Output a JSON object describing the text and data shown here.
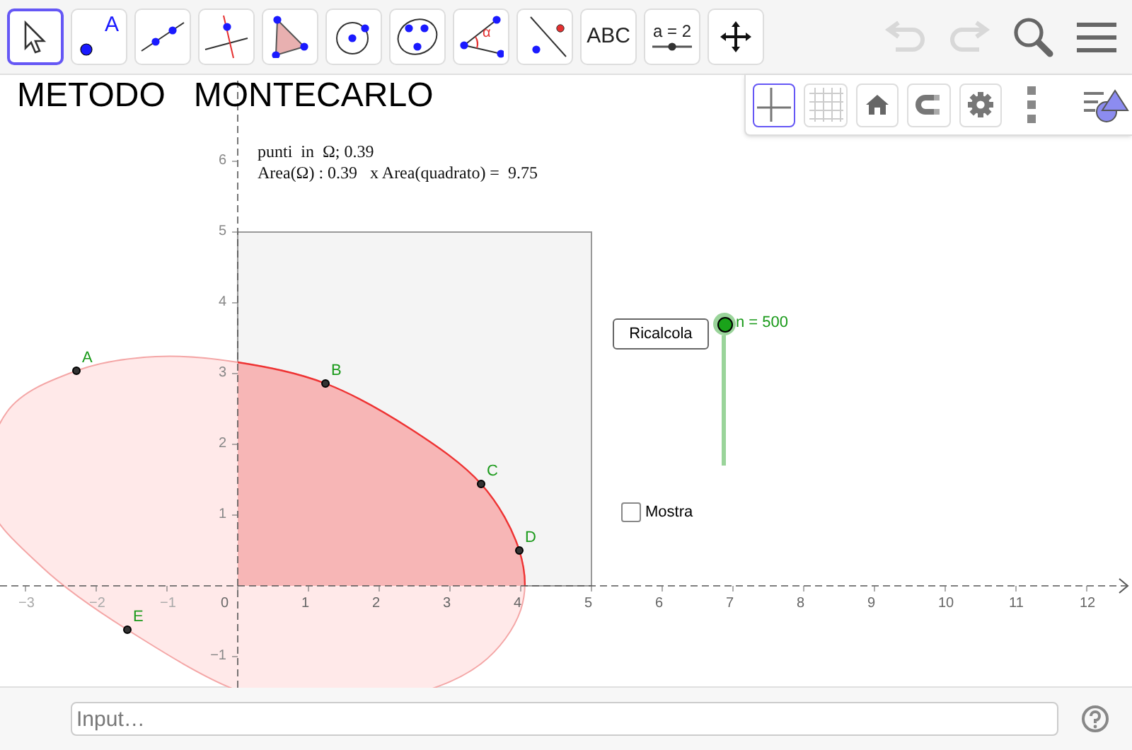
{
  "toolbar": {
    "tools": [
      {
        "kind": "move",
        "selected": true
      },
      {
        "kind": "point",
        "label": "A",
        "selected": false
      },
      {
        "kind": "line",
        "selected": false
      },
      {
        "kind": "perpendicular",
        "selected": false
      },
      {
        "kind": "polygon",
        "selected": false
      },
      {
        "kind": "circle",
        "selected": false
      },
      {
        "kind": "conic",
        "selected": false
      },
      {
        "kind": "angle",
        "label": "α",
        "selected": false
      },
      {
        "kind": "reflect",
        "selected": false
      },
      {
        "kind": "text",
        "label": "ABC",
        "selected": false
      },
      {
        "kind": "slider",
        "label": "a = 2",
        "selected": false
      },
      {
        "kind": "pan",
        "selected": false
      }
    ],
    "actions": [
      {
        "kind": "undo",
        "disabled": true
      },
      {
        "kind": "redo",
        "disabled": true
      },
      {
        "kind": "search",
        "disabled": false
      },
      {
        "kind": "menu",
        "disabled": false
      }
    ]
  },
  "style_bar": {
    "buttons": [
      {
        "kind": "axes",
        "selected": true
      },
      {
        "kind": "grid",
        "selected": false
      },
      {
        "kind": "home",
        "selected": false
      },
      {
        "kind": "magnet",
        "selected": false
      },
      {
        "kind": "settings",
        "selected": false
      },
      {
        "kind": "more",
        "selected": false
      },
      {
        "kind": "styles",
        "selected": false
      }
    ]
  },
  "graphics": {
    "title": "METODO   MONTECARLO",
    "texts": [
      "punti  in  Ω; 0.39",
      "Area(Ω) : 0.39   x Area(quadrato) =  9.75"
    ],
    "x_ticks": [
      "−3",
      "−2",
      "−1",
      "0",
      "1",
      "2",
      "3",
      "4",
      "5",
      "6",
      "7",
      "8",
      "9",
      "10",
      "11",
      "12"
    ],
    "y_ticks": [
      "6",
      "5",
      "4",
      "3",
      "2",
      "1",
      "−1"
    ],
    "points": [
      {
        "label": "A"
      },
      {
        "label": "B"
      },
      {
        "label": "C"
      },
      {
        "label": "D"
      },
      {
        "label": "E"
      }
    ],
    "button": "Ricalcola",
    "slider": {
      "label": "n = 500",
      "level": 1
    },
    "checkbox": {
      "label": "Mostra",
      "checked": false
    }
  },
  "input_bar": {
    "placeholder": "Input…"
  }
}
